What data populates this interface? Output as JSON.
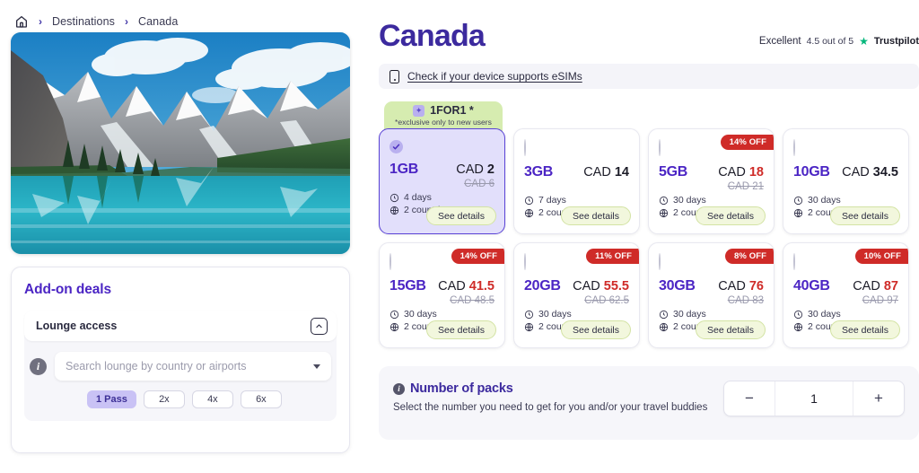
{
  "breadcrumb": {
    "home_icon": "home-icon",
    "separator": "›",
    "items": [
      {
        "label": "Destinations"
      },
      {
        "label": "Canada"
      }
    ]
  },
  "hero": {
    "alt": "moraine-lake-canada-mountains-photo"
  },
  "addon": {
    "title": "Add-on deals",
    "lounge": {
      "label": "Lounge access",
      "collapse_icon": "chevron-up-icon",
      "info_icon": "info-icon",
      "search_placeholder": "Search lounge by country or airports",
      "dropdown_icon": "chevron-down-icon",
      "passes": [
        {
          "label": "1 Pass",
          "selected": true
        },
        {
          "label": "2x",
          "selected": false
        },
        {
          "label": "4x",
          "selected": false
        },
        {
          "label": "6x",
          "selected": false
        }
      ]
    }
  },
  "header": {
    "title": "Canada",
    "trustpilot": {
      "word": "Excellent",
      "score": "4.5 out of 5",
      "star_icon": "star-icon",
      "brand": "Trustpilot",
      "star_color": "#00b67a"
    }
  },
  "esim": {
    "icon": "phone-icon",
    "link_text": "Check if your device supports eSIMs"
  },
  "promo": {
    "icon": "gift-icon",
    "title": "1FOR1 *",
    "subtitle": "*exclusive only to new users",
    "bg_color": "#d6ecb0"
  },
  "plans": {
    "currency": "CAD",
    "see_details_label": "See details",
    "clock_icon": "clock-icon",
    "globe-icon": "globe-icon",
    "items": [
      {
        "size": "1GB",
        "price": "2",
        "old_price": "CAD 6",
        "days": "4 days",
        "countries": "2 countries",
        "discount": "",
        "selected": true
      },
      {
        "size": "3GB",
        "price": "14",
        "old_price": "",
        "days": "7 days",
        "countries": "2 countries",
        "discount": "",
        "selected": false
      },
      {
        "size": "5GB",
        "price": "18",
        "old_price": "CAD 21",
        "days": "30 days",
        "countries": "2 countries",
        "discount": "14% OFF",
        "selected": false
      },
      {
        "size": "10GB",
        "price": "34.5",
        "old_price": "",
        "days": "30 days",
        "countries": "2 countries",
        "discount": "",
        "selected": false
      },
      {
        "size": "15GB",
        "price": "41.5",
        "old_price": "CAD 48.5",
        "days": "30 days",
        "countries": "2 countries",
        "discount": "14% OFF",
        "selected": false
      },
      {
        "size": "20GB",
        "price": "55.5",
        "old_price": "CAD 62.5",
        "days": "30 days",
        "countries": "2 countries",
        "discount": "11% OFF",
        "selected": false
      },
      {
        "size": "30GB",
        "price": "76",
        "old_price": "CAD 83",
        "days": "30 days",
        "countries": "2 countries",
        "discount": "8% OFF",
        "selected": false
      },
      {
        "size": "40GB",
        "price": "87",
        "old_price": "CAD 97",
        "days": "30 days",
        "countries": "2 countries",
        "discount": "10% OFF",
        "selected": false
      }
    ]
  },
  "packs": {
    "info_icon": "info-icon",
    "title": "Number of packs",
    "description": "Select the number you need to get for you and/or your travel buddies",
    "decrement_label": "−",
    "value": "1",
    "increment_label": "+"
  }
}
